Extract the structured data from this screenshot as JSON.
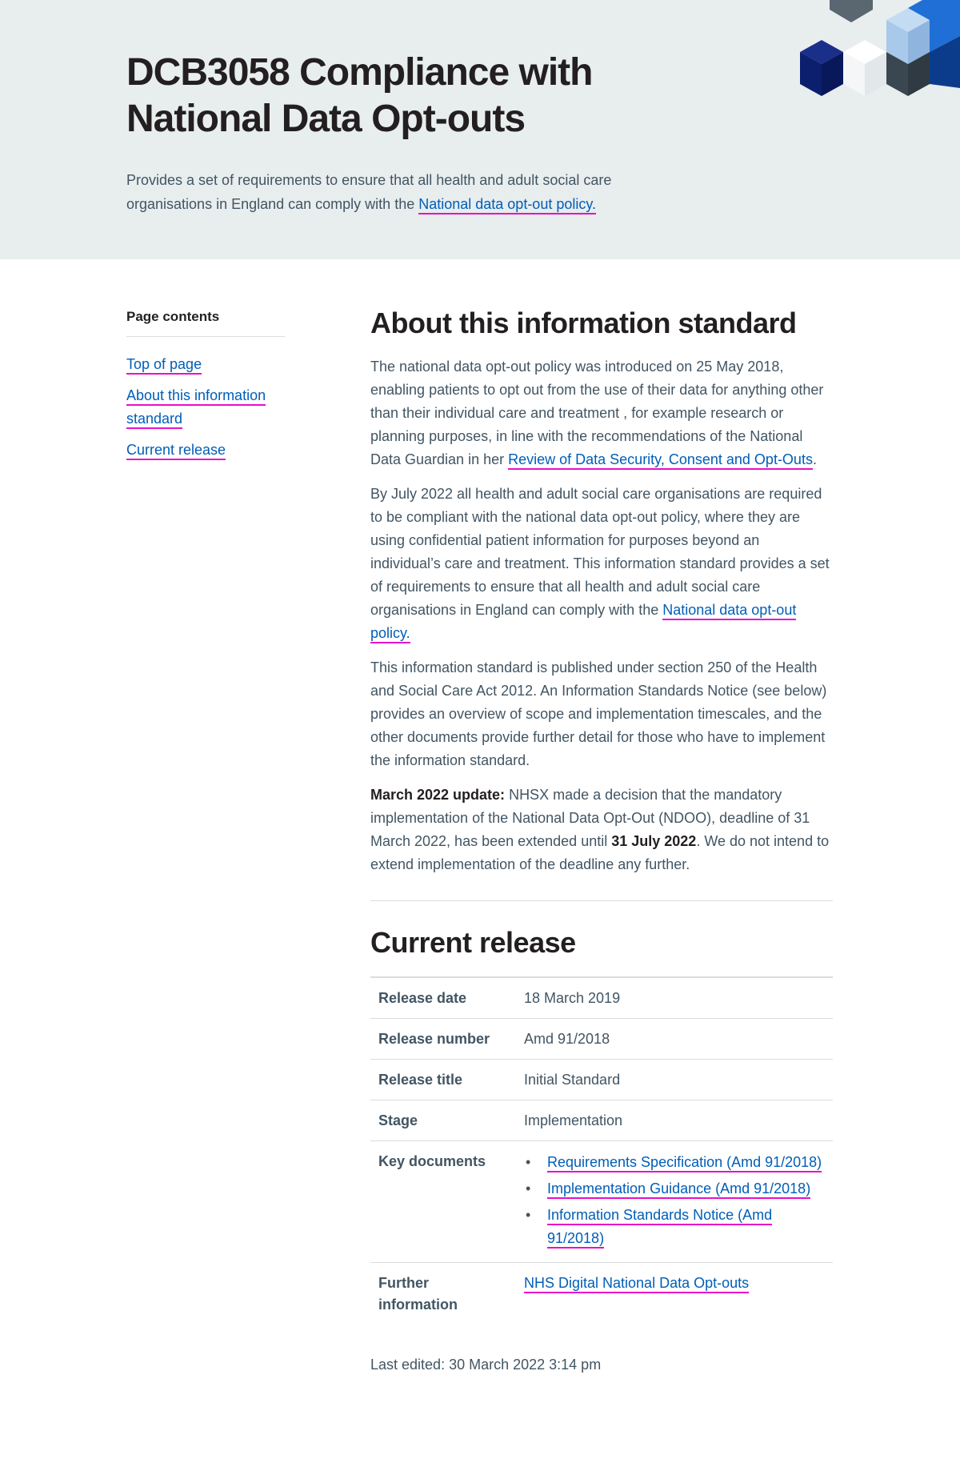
{
  "hero": {
    "title_line1": "DCB3058 Compliance with",
    "title_line2": "National Data Opt-outs",
    "summary_prefix": "Provides a set of requirements to ensure that all health and adult social care organisations in England can comply with the ",
    "summary_link": "National data opt-out policy."
  },
  "sidebar": {
    "title": "Page contents",
    "items": [
      {
        "label": "Top of page"
      },
      {
        "label": "About this information standard"
      },
      {
        "label": "Current release"
      }
    ]
  },
  "about": {
    "heading": "About this information standard",
    "p1_text": "The national data opt-out policy was introduced on 25 May 2018, enabling patients to opt out from the use of their data for anything other than their individual care and treatment , for example research or planning purposes, in line with the recommendations of the National Data Guardian in her ",
    "p1_link": "Review of Data Security, Consent and Opt-Outs",
    "p1_end": ".",
    "p2_text": "By July 2022 all health and adult social care organisations are required to be compliant with the national data opt-out policy, where they are using confidential patient information for purposes beyond an individual’s care and treatment. This information standard provides a set of requirements to ensure that all health and adult social care organisations in England can comply with the ",
    "p2_link": "National data opt-out policy.",
    "p3_text": "This information standard is published under section 250 of the Health and Social Care Act 2012. An Information Standards Notice (see below) provides an overview of scope and implementation timescales, and the other documents provide further detail for those who have to implement the information standard.",
    "p4_bold": "March 2022 update:",
    "p4_text1": " NHSX made a decision that the mandatory implementation of the National Data Opt-Out (NDOO), deadline of 31 March 2022, has been extended until ",
    "p4_bold2": "31 July 2022",
    "p4_text2": ". We do not intend to extend implementation of the deadline any further."
  },
  "release": {
    "heading": "Current release",
    "rows": [
      {
        "key": "Release date",
        "value": "18 March 2019"
      },
      {
        "key": "Release number",
        "value": "Amd 91/2018"
      },
      {
        "key": "Release title",
        "value": "Initial Standard"
      },
      {
        "key": "Stage",
        "value": "Implementation"
      }
    ],
    "key_documents_label": "Key documents",
    "documents": [
      {
        "label": "Requirements Specification (Amd 91/2018)"
      },
      {
        "label": "Implementation Guidance (Amd 91/2018)"
      },
      {
        "label": "Information Standards Notice (Amd 91/2018)"
      }
    ],
    "further_label": "Further information",
    "further_link": "NHS Digital National Data Opt-outs"
  },
  "last_edited": "Last edited: 30 March 2022 3:14 pm",
  "colors": {
    "hero_bg": "#e8edee",
    "link": "#005eb8",
    "link_underline": "#e810c8",
    "text": "#425563",
    "heading": "#231f20"
  }
}
